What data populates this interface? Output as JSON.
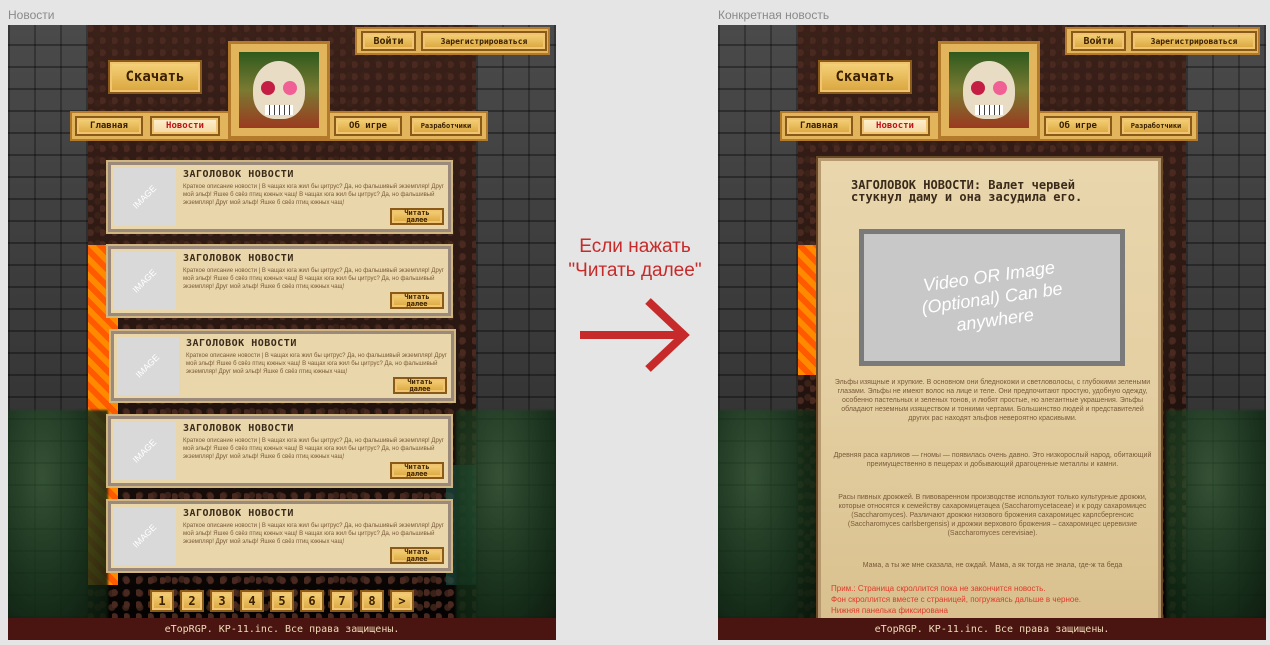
{
  "frames": {
    "left_label": "Новости",
    "right_label": "Конкретная новость"
  },
  "header": {
    "download": "Скачать",
    "login": "Войти",
    "register": "Зарегистрироваться",
    "nav": [
      "Главная",
      "Новости",
      "Об игре",
      "Разработчики"
    ]
  },
  "cards": [
    {
      "image": "IMAGE",
      "title": "ЗАГОЛОВОК НОВОСТИ",
      "desc": "Краткое описание новости | В чащах юга жил бы цитрус? Да, но фальшивый экземпляр! Друг мой эльф! Яшке б свёз птиц южных чащ! В чащах юга жил бы цитрус? Да, но фальшивый экземпляр! Друг мой эльф! Яшке б свёз птиц южных чащ!",
      "read": "Читать далее"
    },
    {
      "image": "IMAGE",
      "title": "ЗАГОЛОВОК НОВОСТИ",
      "desc": "Краткое описание новости | В чащах юга жил бы цитрус? Да, но фальшивый экземпляр! Друг мой эльф! Яшке б свёз птиц южных чащ! В чащах юга жил бы цитрус? Да, но фальшивый экземпляр! Друг мой эльф! Яшке б свёз птиц южных чащ!",
      "read": "Читать далее"
    },
    {
      "image": "IMAGE",
      "title": "ЗАГОЛОВОК НОВОСТИ",
      "desc": "Краткое описание новости | В чащах юга жил бы цитрус? Да, но фальшивый экземпляр! Друг мой эльф! Яшке б свёз птиц южных чащ! В чащах юга жил бы цитрус? Да, но фальшивый экземпляр! Друг мой эльф! Яшке б свёз птиц южных чащ!",
      "read": "Читать далее"
    },
    {
      "image": "IMAGE",
      "title": "ЗАГОЛОВОК НОВОСТИ",
      "desc": "Краткое описание новости | В чащах юга жил бы цитрус? Да, но фальшивый экземпляр! Друг мой эльф! Яшке б свёз птиц южных чащ! В чащах юга жил бы цитрус? Да, но фальшивый экземпляр! Друг мой эльф! Яшке б свёз птиц южных чащ!",
      "read": "Читать далее"
    },
    {
      "image": "IMAGE",
      "title": "ЗАГОЛОВОК НОВОСТИ",
      "desc": "Краткое описание новости | В чащах юга жил бы цитрус? Да, но фальшивый экземпляр! Друг мой эльф! Яшке б свёз птиц южных чащ! В чащах юга жил бы цитрус? Да, но фальшивый экземпляр! Друг мой эльф! Яшке б свёз птиц южных чащ!",
      "read": "Читать далее"
    }
  ],
  "pagination": [
    "1",
    "2",
    "3",
    "4",
    "5",
    "6",
    "7",
    "8",
    ">"
  ],
  "footer": "eTopRGP. KP-11.inc. Все права защищены.",
  "transition_label": "Если нажать \"Читать далее\"",
  "article": {
    "title": "ЗАГОЛОВОК НОВОСТИ: Валет червей стукнул даму и она засудила его.",
    "media": "Video OR Image (Optional) Can be anywhere",
    "paragraphs": [
      "Эльфы изящные и хрупкие. В основном они бледнокожи и светловолосы, с глубокими зелеными глазами. Эльфы не имеют волос на лице и теле. Они предпочитают простую, удобную одежду, особенно пастельных и зеленых тонов, и любят простые, но элегантные украшения. Эльфы обладают неземным изяществом и тонкими чертами. Большинство людей и представителей других рас находят эльфов невероятно красивыми.",
      "Древняя раса карликов — гномы — появилась очень давно. Это низкорослый народ, обитающий преимущественно в пещерах и добывающий драгоценные металлы и камни.",
      "Расы пивных дрожжей. В пивоваренном производстве используют только культурные дрожжи, которые относятся к семейству сахаромицетацеа (Saccharomycetaceae) и к роду сахаромицес (Saccharomyces). Различают дрожжи низового брожения сахаромицес карлсбергенсис (Saccharomyces carlsbergensis) и дрожжи верхового брожения – сахаромицес церевизие (Saccharomyces cerevisiae).",
      "Мама, а ты же мне сказала, не ождай. Мама, а як тогда не знала, где-ж та беда"
    ],
    "note": "Прим.: Страница скроллится пока не закончится новость.\nФон скроллится вместе с страницей, погружаясь дальше в черное.\nНижняя панелька фиксирована"
  }
}
